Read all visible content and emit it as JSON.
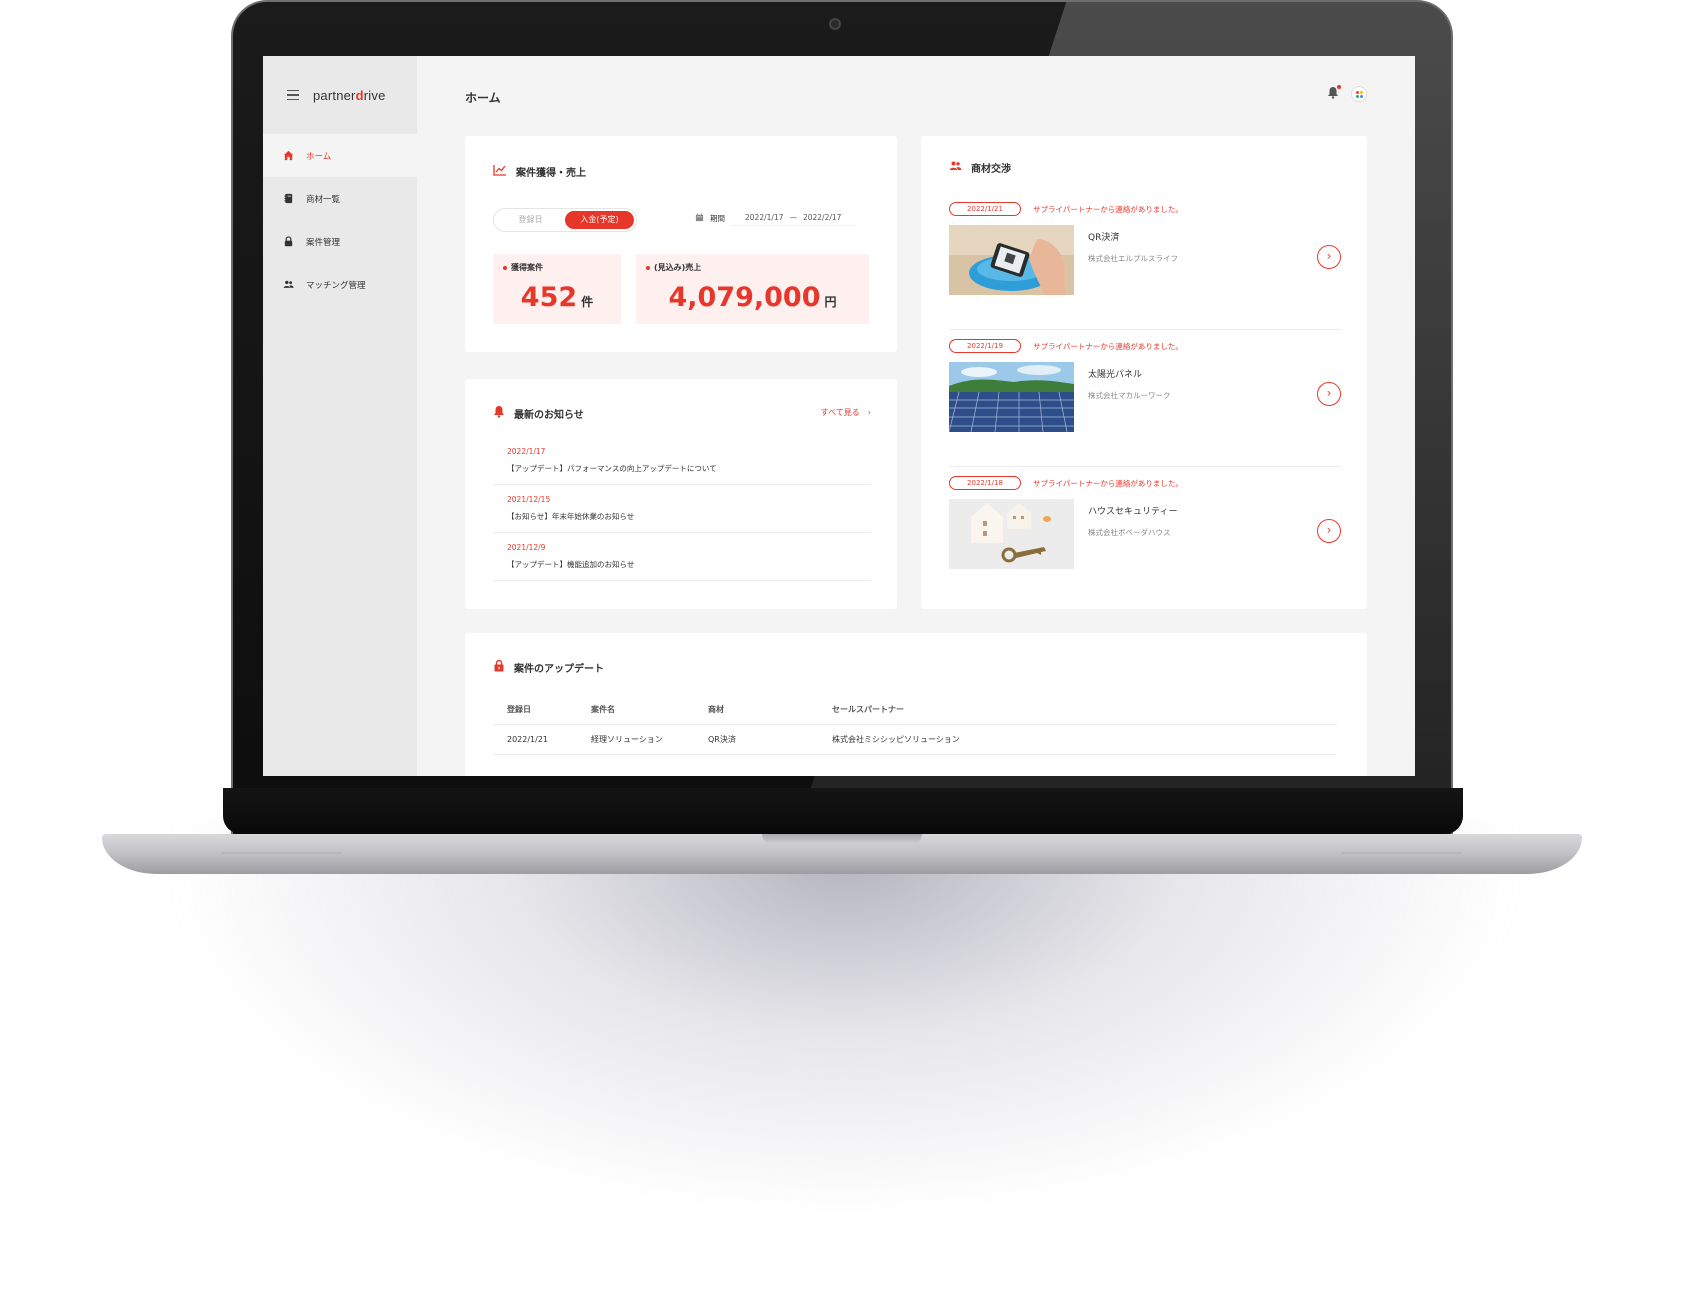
{
  "sidebar": {
    "logo_text": "partner",
    "logo_d": "d",
    "logo_rest": "rive",
    "items": [
      {
        "label": "ホーム",
        "icon": "home-icon",
        "active": true
      },
      {
        "label": "商材一覧",
        "icon": "book-icon"
      },
      {
        "label": "案件管理",
        "icon": "lock-icon"
      },
      {
        "label": "マッチング管理",
        "icon": "users-icon"
      }
    ]
  },
  "header": {
    "title": "ホーム"
  },
  "sales": {
    "title": "案件獲得・売上",
    "toggle": [
      "登録日",
      "入金(予定)"
    ],
    "period_label": "期間",
    "period_from": "2022/1/17",
    "period_sep": "—",
    "period_to": "2022/2/17",
    "kpis": [
      {
        "label": "獲得案件",
        "value": "452",
        "unit": "件"
      },
      {
        "label": "(見込み)売上",
        "value": "4,079,000",
        "unit": "円"
      }
    ]
  },
  "news": {
    "title": "最新のお知らせ",
    "see_all": "すべて見る",
    "items": [
      {
        "date": "2022/1/17",
        "text": "【アップデート】パフォーマンスの向上アップデートについて"
      },
      {
        "date": "2021/12/15",
        "text": "【お知らせ】年末年始休業のお知らせ"
      },
      {
        "date": "2021/12/9",
        "text": "【アップデート】機能追加のお知らせ"
      }
    ]
  },
  "negotiation": {
    "title": "商材交渉",
    "items": [
      {
        "date": "2022/1/21",
        "message": "サプライパートナーから連絡がありました。",
        "name": "QR決済",
        "company": "株式会社エルプルスライフ"
      },
      {
        "date": "2022/1/19",
        "message": "サプライパートナーから連絡がありました。",
        "name": "太陽光パネル",
        "company": "株式会社マカルーワーク"
      },
      {
        "date": "2022/1/18",
        "message": "サプライパートナーから連絡がありました。",
        "name": "ハウスセキュリティー",
        "company": "株式会社ボベーダハウス"
      }
    ]
  },
  "updates": {
    "title": "案件のアップデート",
    "columns": [
      "登録日",
      "案件名",
      "商材",
      "セールスパートナー"
    ],
    "rows": [
      [
        "2022/1/21",
        "経理ソリューション",
        "QR決済",
        "株式会社ミシシッピソリューション"
      ]
    ]
  },
  "colors": {
    "accent": "#e7372a",
    "kpi_bg": "#fdf0ef",
    "sidebar_bg": "#e9e9e9",
    "page_bg": "#f4f4f4"
  }
}
